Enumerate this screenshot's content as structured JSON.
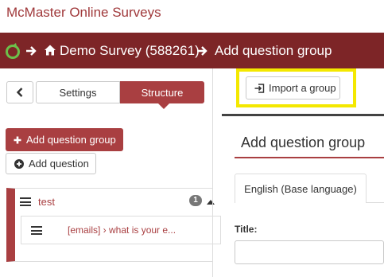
{
  "app": {
    "title": "McMaster Online Surveys"
  },
  "breadcrumb": {
    "survey": "Demo Survey (588261)",
    "current": "Add question group"
  },
  "sidebar": {
    "tabs": [
      {
        "label": "Settings",
        "active": false
      },
      {
        "label": "Structure",
        "active": true
      }
    ],
    "add_group_label": "Add question group",
    "add_question_label": "Add question",
    "groups": [
      {
        "name": "test",
        "question_count": "1",
        "questions": [
          {
            "label": "[emails] › what is your e..."
          }
        ]
      }
    ]
  },
  "toolbar": {
    "import_label": "Import a group"
  },
  "main": {
    "heading": "Add question group",
    "language_tab": "English (Base language)",
    "title_label": "Title:",
    "title_value": ""
  },
  "colors": {
    "brand": "#7d2527",
    "accent": "#a93f41",
    "highlight": "#f4e800",
    "logo": "#6cc04a"
  },
  "icons": {
    "logo": "survey-logo-icon",
    "crumb_arrow": "arrow-right-icon",
    "home": "home-icon",
    "back": "chevron-left-icon",
    "add_group": "plus-icon",
    "add_question": "plus-circle-icon",
    "drag": "hamburger-icon",
    "import": "import-icon",
    "collapse": "caret-up-icon"
  }
}
